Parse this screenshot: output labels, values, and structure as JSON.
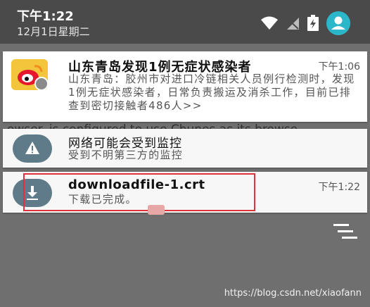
{
  "status_bar": {
    "time": "下午1:22",
    "date": "12月1日星期二"
  },
  "background_text": "owser. is configured to use Chunes as its browse",
  "notifications": [
    {
      "app_icon": "weibo-icon",
      "title": "山东青岛发现1例无症状感染者",
      "time": "下午1:06",
      "body": "山东青岛：胶州市对进口冷链相关人员例行检测时，发现1例无症状感染者，日常负责搬运及消杀工作，目前已排查到密切接触者486人>>"
    },
    {
      "app_icon": "warning-icon",
      "title": "网络可能会受到监控",
      "body": "受到不明第三方的监控"
    },
    {
      "app_icon": "download-icon",
      "title": "downloadfile-1.crt",
      "time": "下午1:22",
      "body": "下载已完成。"
    }
  ],
  "watermark": "https://blog.csdn.net/xiaofann",
  "colors": {
    "status_bar": "#4a4a4a",
    "highlight_border": "#e0313b",
    "icon_circle": "#5f7a89",
    "weibo_yellow": "#f3c53a"
  }
}
